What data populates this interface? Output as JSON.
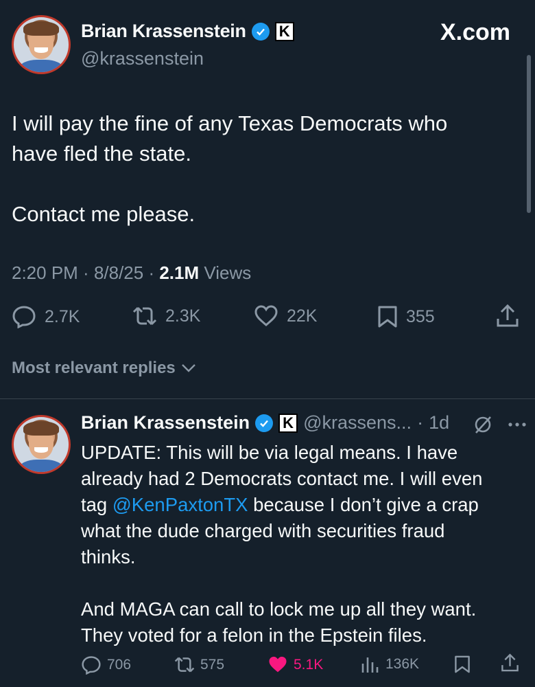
{
  "brand": {
    "site": "X.com"
  },
  "colors": {
    "background": "#15202b",
    "accent": "#1d9bf0",
    "like": "#f91880",
    "muted": "#8b98a5"
  },
  "tweet": {
    "author_name": "Brian Krassenstein",
    "handle": "@krassenstein",
    "badge_letter": "K",
    "text_lines": [
      "I will pay the fine of any Texas Democrats who",
      "have fled the state."
    ],
    "text_second": "Contact me please.",
    "time": "2:20 PM",
    "date": "8/8/25",
    "views_count": "2.1M",
    "views_label": "Views",
    "replies": "2.7K",
    "retweets": "2.3K",
    "likes": "22K",
    "bookmarks": "355"
  },
  "sort": {
    "label": "Most relevant replies"
  },
  "reply": {
    "author_name": "Brian Krassenstein",
    "badge_letter": "K",
    "handle": "@krassens...",
    "age": "1d",
    "line1": "UPDATE: This will be via legal means. I have",
    "line2": "already had 2 Democrats contact me. I will even",
    "line3_pre": "tag ",
    "mention": "@KenPaxtonTX",
    "line3_post": " because I don’t give a crap",
    "line4": "what the dude charged with securities fraud",
    "line5": "thinks.",
    "line6": "And MAGA can call to lock me up all they want.",
    "line7": "They voted for a felon in the Epstein files.",
    "replies": "706",
    "retweets": "575",
    "likes": "5.1K",
    "views": "136K"
  }
}
